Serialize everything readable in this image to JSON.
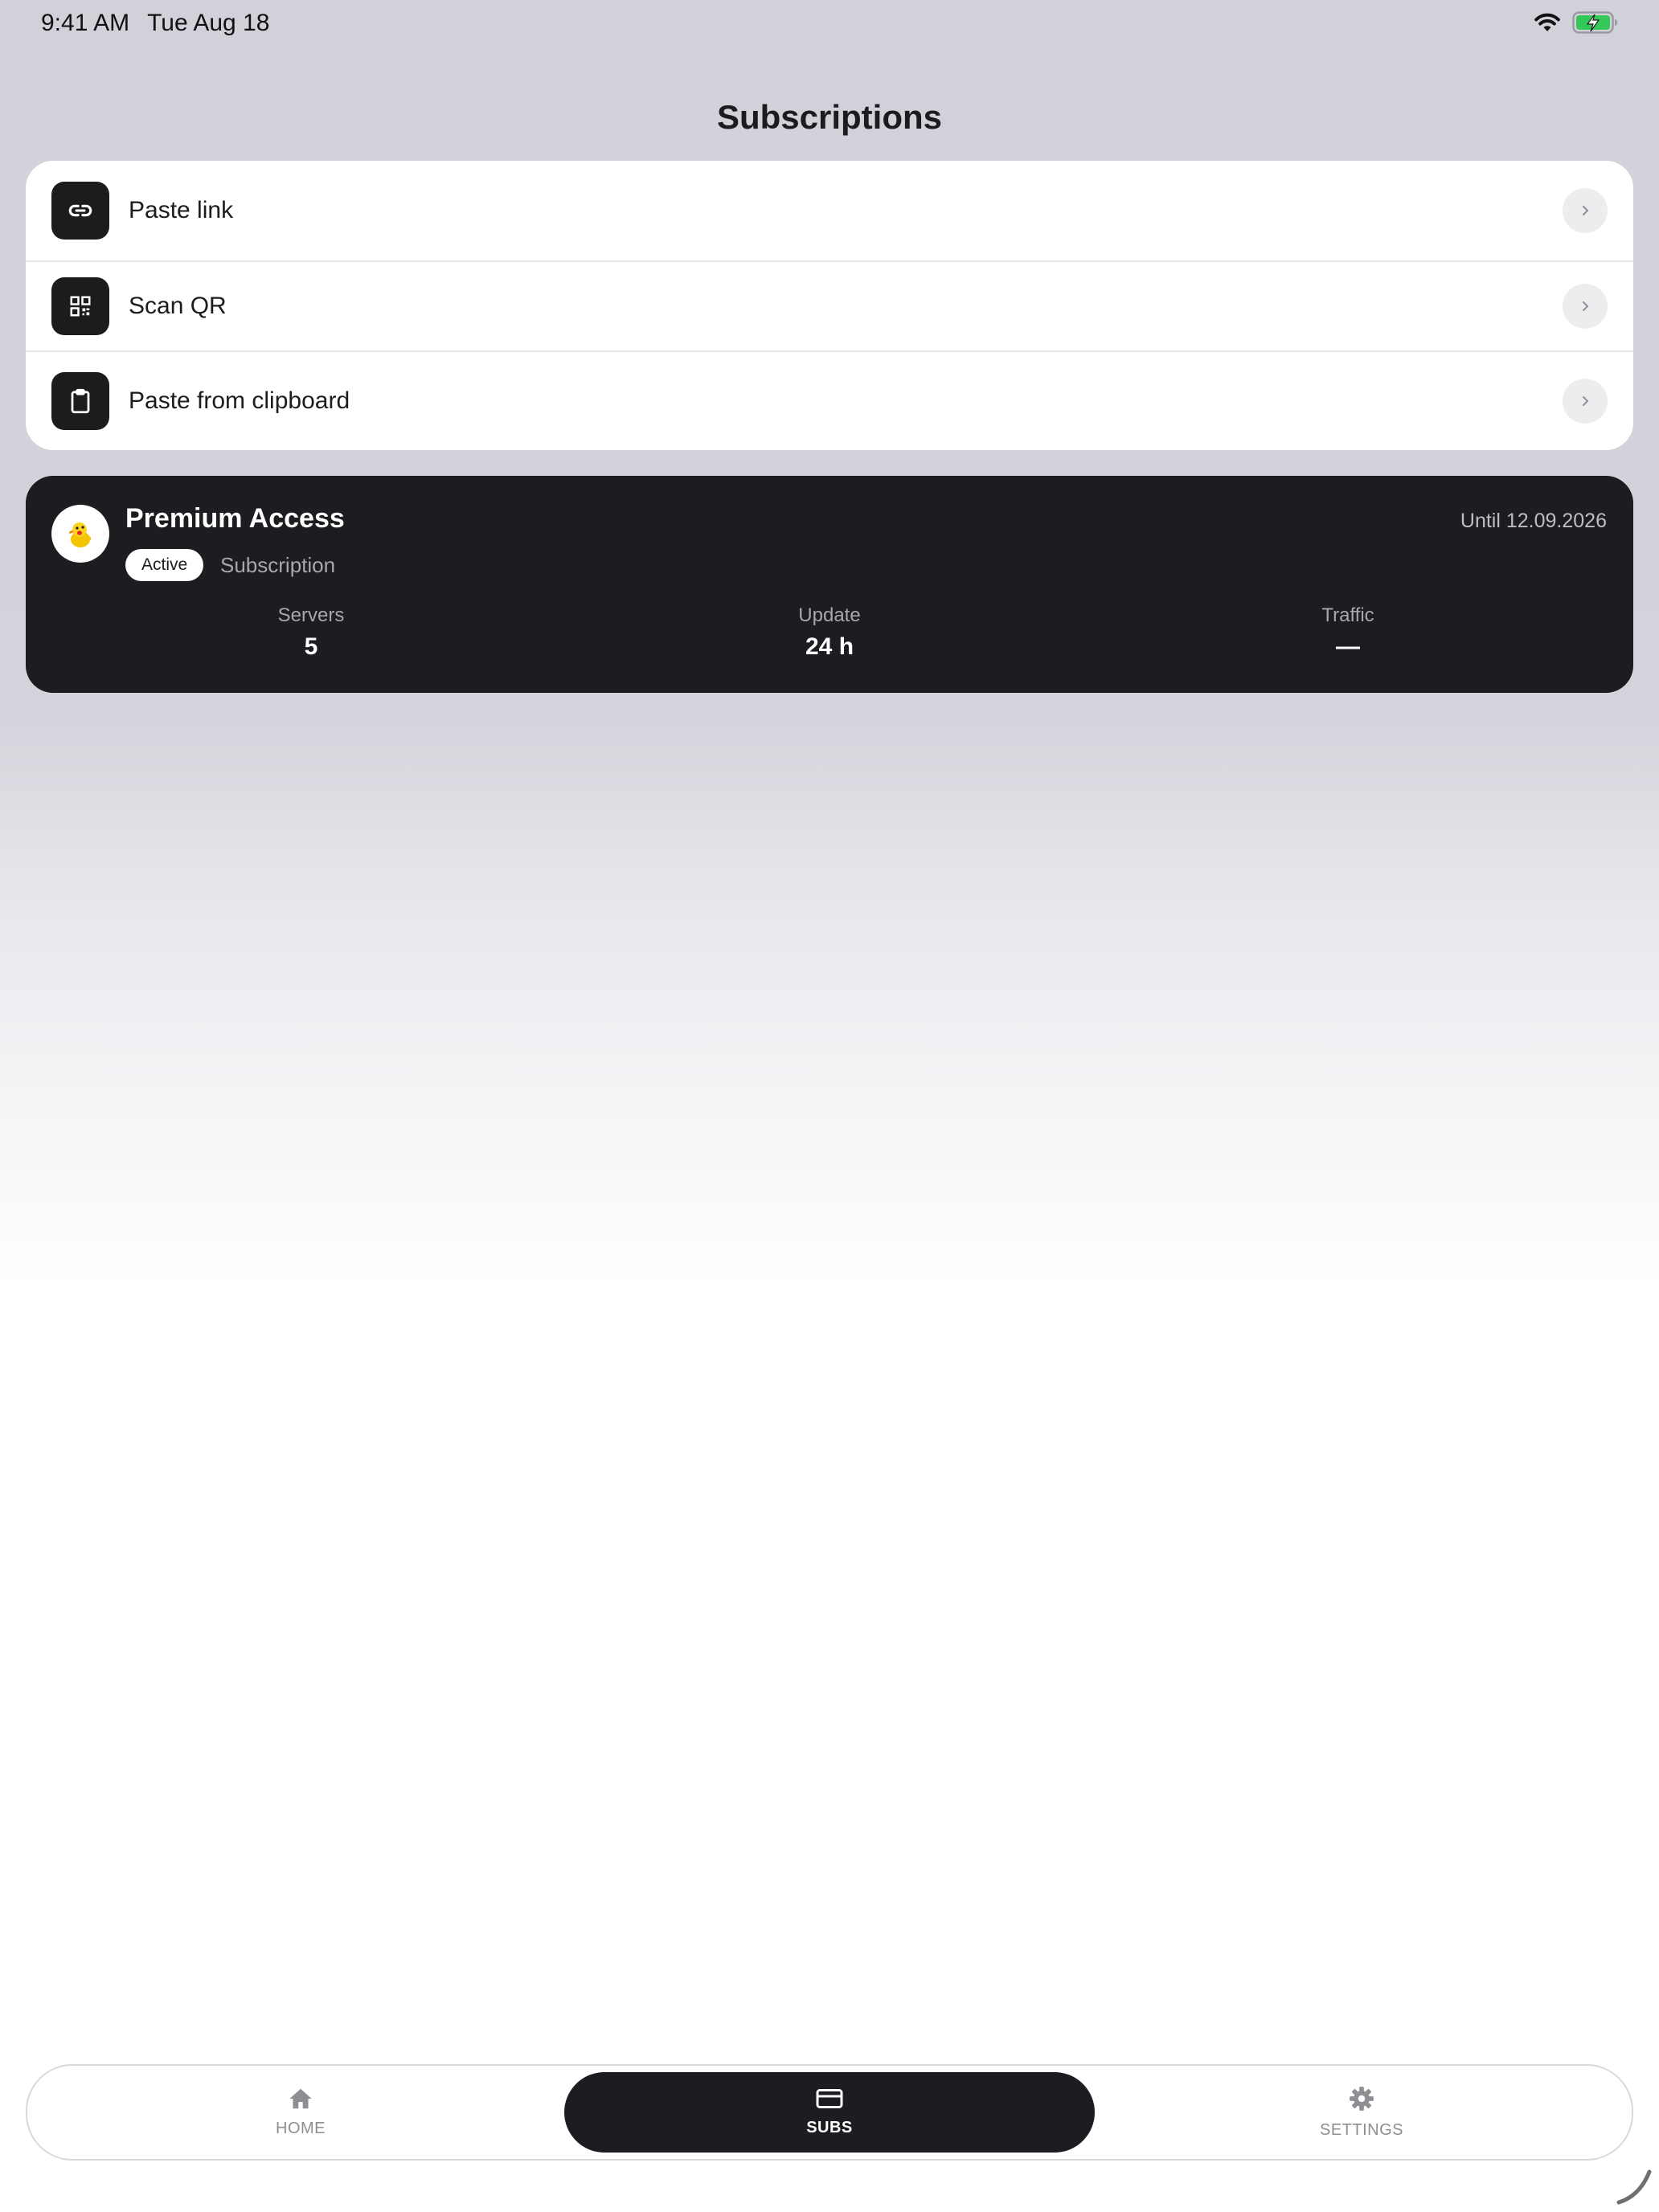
{
  "status_bar": {
    "time": "9:41 AM",
    "date": "Tue Aug 18",
    "icons": [
      "wifi-icon",
      "battery-charging-icon"
    ],
    "battery_color": "#34c759"
  },
  "page_title": "Subscriptions",
  "actions": [
    {
      "label": "Paste link",
      "icon": "link-icon"
    },
    {
      "label": "Scan QR",
      "icon": "qr-code-icon"
    },
    {
      "label": "Paste from clipboard",
      "icon": "clipboard-icon"
    }
  ],
  "subscription": {
    "name": "Premium Access",
    "status": "Active",
    "type": "Subscription",
    "until": "Until 12.09.2026",
    "avatar_icon": "duck-emoji-icon",
    "stats": [
      {
        "label": "Servers",
        "value": "5"
      },
      {
        "label": "Update",
        "value": "24 h"
      },
      {
        "label": "Traffic",
        "value": "—"
      }
    ]
  },
  "tab_bar": {
    "tabs": [
      {
        "label": "HOME",
        "icon": "home-icon",
        "active": false
      },
      {
        "label": "SUBS",
        "icon": "card-icon",
        "active": true
      },
      {
        "label": "SETTINGS",
        "icon": "gear-icon",
        "active": false
      }
    ]
  },
  "colors": {
    "dark_surface": "#1d1d21",
    "muted_text": "#8e8e93"
  }
}
